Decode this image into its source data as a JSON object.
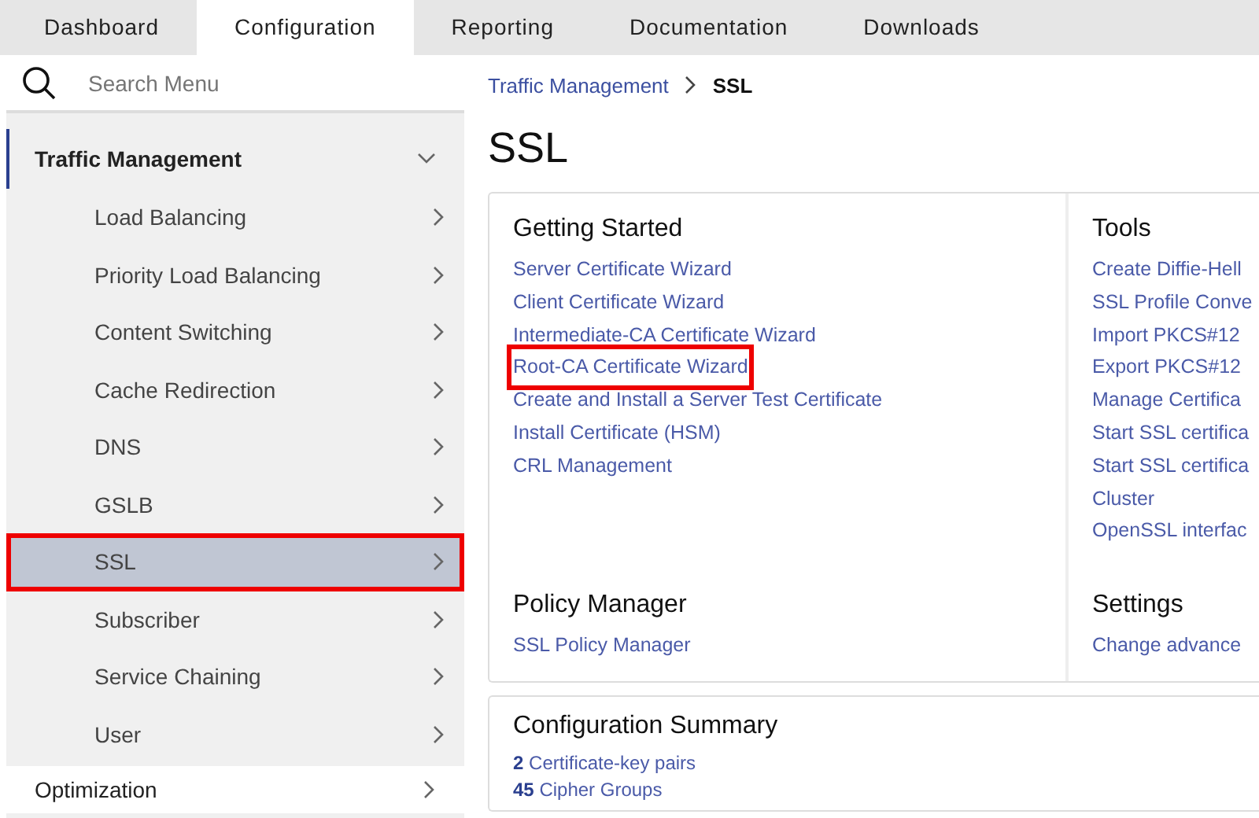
{
  "tabs": [
    {
      "label": "Dashboard",
      "selected": false
    },
    {
      "label": "Configuration",
      "selected": true
    },
    {
      "label": "Reporting",
      "selected": false
    },
    {
      "label": "Documentation",
      "selected": false
    },
    {
      "label": "Downloads",
      "selected": false
    }
  ],
  "sidebar": {
    "search": {
      "placeholder": "Search Menu"
    },
    "groups": [
      {
        "label": "Traffic Management",
        "expanded": true,
        "children": [
          {
            "label": "Load Balancing",
            "selected": false,
            "highlighted": false
          },
          {
            "label": "Priority Load Balancing",
            "selected": false,
            "highlighted": false
          },
          {
            "label": "Content Switching",
            "selected": false,
            "highlighted": false
          },
          {
            "label": "Cache Redirection",
            "selected": false,
            "highlighted": false
          },
          {
            "label": "DNS",
            "selected": false,
            "highlighted": false
          },
          {
            "label": "GSLB",
            "selected": false,
            "highlighted": false
          },
          {
            "label": "SSL",
            "selected": true,
            "highlighted": true
          },
          {
            "label": "Subscriber",
            "selected": false,
            "highlighted": false
          },
          {
            "label": "Service Chaining",
            "selected": false,
            "highlighted": false
          },
          {
            "label": "User",
            "selected": false,
            "highlighted": false
          }
        ]
      },
      {
        "label": "Optimization",
        "expanded": false
      }
    ]
  },
  "breadcrumb": {
    "parent": "Traffic Management",
    "current": "SSL"
  },
  "title": "SSL",
  "sections": [
    {
      "left": {
        "heading": "Getting Started",
        "links": [
          {
            "text": "Server Certificate Wizard",
            "highlighted": false
          },
          {
            "text": "Client Certificate Wizard",
            "highlighted": false
          },
          {
            "text": "Intermediate-CA Certificate Wizard",
            "highlighted": false
          },
          {
            "text": "Root-CA Certificate Wizard",
            "highlighted": true
          },
          {
            "text": "Create and Install a Server Test Certificate",
            "highlighted": false
          },
          {
            "text": "Install Certificate (HSM)",
            "highlighted": false
          },
          {
            "text": "CRL Management",
            "highlighted": false
          }
        ]
      },
      "right": {
        "heading": "Tools",
        "links": [
          {
            "text": "Create Diffie-Hell",
            "highlighted": false
          },
          {
            "text": "SSL Profile Conve",
            "highlighted": false
          },
          {
            "text": "Import PKCS#12",
            "highlighted": false
          },
          {
            "text": "Export PKCS#12",
            "highlighted": false
          },
          {
            "text": "Manage Certifica",
            "highlighted": false
          },
          {
            "text": "Start SSL certifica",
            "highlighted": false
          },
          {
            "text": "Start SSL certifica\nCluster",
            "highlighted": false
          },
          {
            "text": "OpenSSL interfac",
            "highlighted": false
          }
        ]
      }
    },
    {
      "left": {
        "heading": "Policy Manager",
        "links": [
          {
            "text": "SSL Policy Manager"
          }
        ]
      },
      "right": {
        "heading": "Settings",
        "links": [
          {
            "text": "Change advance"
          }
        ]
      }
    }
  ],
  "summary": {
    "heading": "Configuration Summary",
    "items": [
      "**2** Certificate-key pairs",
      "**45** Cipher Groups"
    ]
  }
}
